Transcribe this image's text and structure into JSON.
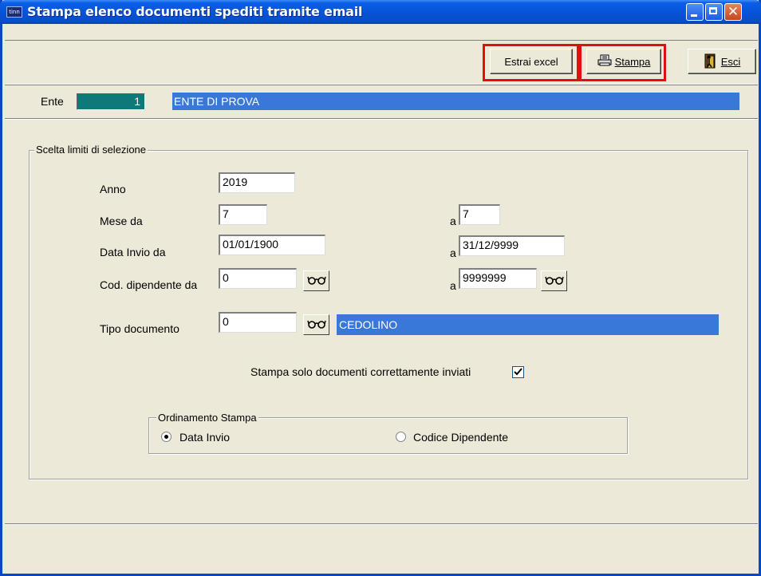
{
  "window": {
    "title": "Stampa elenco documenti spediti tramite email",
    "icon_text": "tinn",
    "controls": [
      "minimize-icon",
      "maximize-icon",
      "close-icon"
    ]
  },
  "toolbar": {
    "excel_label": "Estrai excel",
    "stampa_label": "Stampa",
    "esci_label": "Esci",
    "stampa_icon": "printer-icon",
    "esci_icon": "exit-door-icon",
    "highlight_color": "#e01010"
  },
  "ente": {
    "label": "Ente",
    "code": "1",
    "description": "ENTE DI PROVA",
    "code_bg": "#0f7878",
    "desc_bg": "#3a78d8"
  },
  "selection": {
    "group_title": "Scelta limiti di selezione",
    "anno_label": "Anno",
    "anno_value": "2019",
    "mese_label": "Mese da",
    "mese_da": "7",
    "mese_a_label": "a",
    "mese_a": "7",
    "data_label": "Data Invio da",
    "data_da": "01/01/1900",
    "data_a_label": "a",
    "data_a": "31/12/9999",
    "cod_label": "Cod. dipendente da",
    "cod_da": "0",
    "cod_a_label": "a",
    "cod_a": "9999999",
    "tipo_label": "Tipo documento",
    "tipo_value": "0",
    "tipo_desc": "CEDOLINO",
    "lookup_icon": "glasses-icon",
    "solo_label": "Stampa solo documenti correttamente inviati",
    "solo_checked": true
  },
  "ordinamento": {
    "group_title": "Ordinamento Stampa",
    "option_data": "Data Invio",
    "option_codice": "Codice Dipendente",
    "selected": "Data Invio"
  }
}
